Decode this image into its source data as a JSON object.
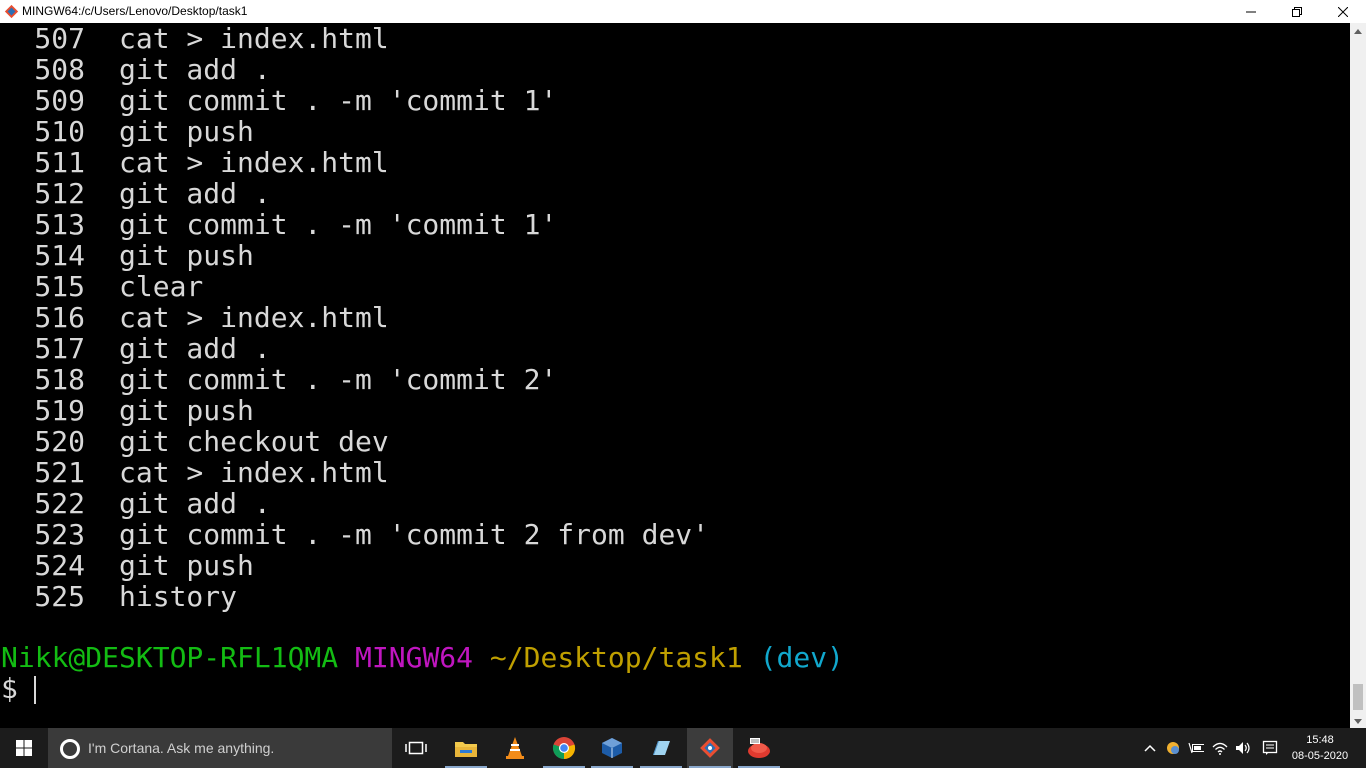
{
  "window": {
    "title": "MINGW64:/c/Users/Lenovo/Desktop/task1"
  },
  "terminal": {
    "history": [
      {
        "num": "507",
        "cmd": "cat > index.html"
      },
      {
        "num": "508",
        "cmd": "git add ."
      },
      {
        "num": "509",
        "cmd": "git commit . -m 'commit 1'"
      },
      {
        "num": "510",
        "cmd": "git push"
      },
      {
        "num": "511",
        "cmd": "cat > index.html"
      },
      {
        "num": "512",
        "cmd": "git add ."
      },
      {
        "num": "513",
        "cmd": "git commit . -m 'commit 1'"
      },
      {
        "num": "514",
        "cmd": "git push"
      },
      {
        "num": "515",
        "cmd": "clear"
      },
      {
        "num": "516",
        "cmd": "cat > index.html"
      },
      {
        "num": "517",
        "cmd": "git add ."
      },
      {
        "num": "518",
        "cmd": "git commit . -m 'commit 2'"
      },
      {
        "num": "519",
        "cmd": "git push"
      },
      {
        "num": "520",
        "cmd": "git checkout dev"
      },
      {
        "num": "521",
        "cmd": "cat > index.html"
      },
      {
        "num": "522",
        "cmd": "git add ."
      },
      {
        "num": "523",
        "cmd": "git commit . -m 'commit 2 from dev'"
      },
      {
        "num": "524",
        "cmd": "git push"
      },
      {
        "num": "525",
        "cmd": "history"
      }
    ],
    "prompt": {
      "user_host": "Nikk@DESKTOP-RFL1QMA",
      "system": "MINGW64",
      "path": "~/Desktop/task1",
      "branch": "(dev)",
      "symbol": "$"
    },
    "colors": {
      "user_host": "#13bc13",
      "system": "#c016c0",
      "path": "#c0a000",
      "branch": "#11a8cd",
      "text": "#d8d8d8",
      "background": "#000000"
    }
  },
  "taskbar": {
    "search_placeholder": "I'm Cortana. Ask me anything.",
    "apps": [
      {
        "name": "task-view",
        "icon": "task-view-icon"
      },
      {
        "name": "file-explorer",
        "icon": "folder-icon"
      },
      {
        "name": "vlc",
        "icon": "vlc-cone-icon"
      },
      {
        "name": "chrome",
        "icon": "chrome-icon"
      },
      {
        "name": "virtualbox",
        "icon": "virtualbox-icon"
      },
      {
        "name": "notepad",
        "icon": "notepad-icon"
      },
      {
        "name": "git-bash",
        "icon": "git-icon"
      },
      {
        "name": "oracle-sql",
        "icon": "database-icon"
      }
    ],
    "clock": {
      "time": "15:48",
      "date": "08-05-2020"
    }
  }
}
